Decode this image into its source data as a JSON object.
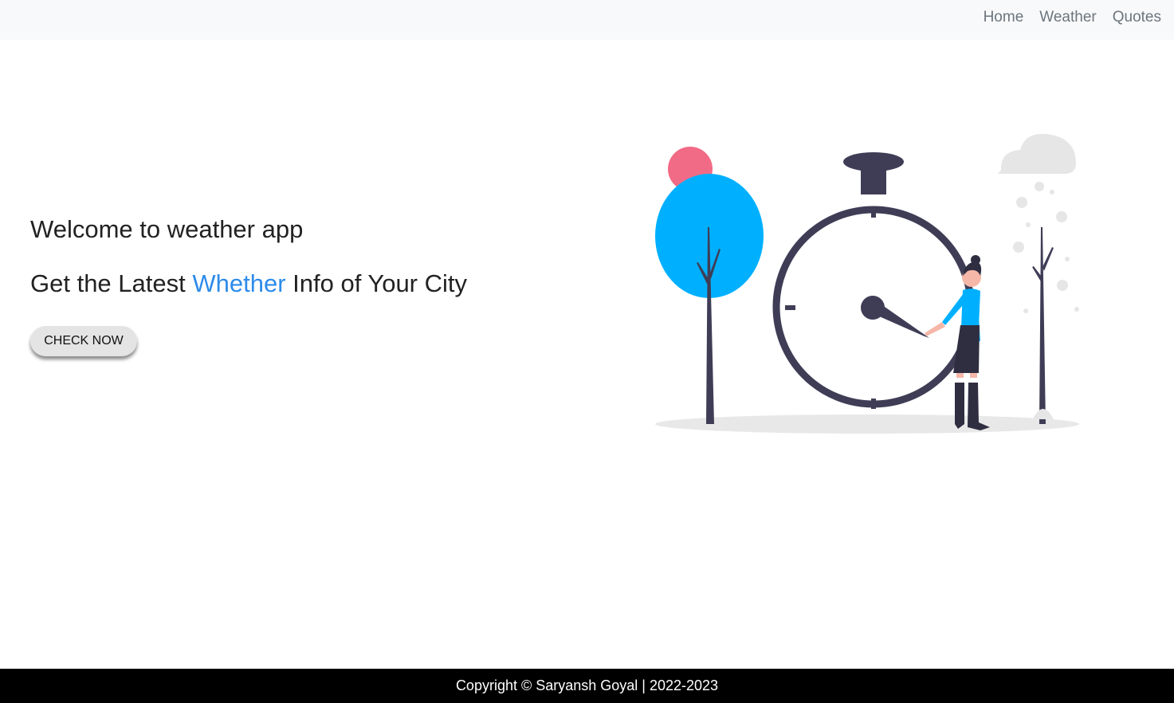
{
  "nav": {
    "links": [
      "Home",
      "Weather",
      "Quotes"
    ]
  },
  "hero": {
    "title": "Welcome to weather app",
    "subtitle_pre": "Get the Latest ",
    "subtitle_highlight": "Whether",
    "subtitle_post": " Info of Your City",
    "button_label": "CHECK NOW",
    "illustration_icon": "clock-illustration"
  },
  "footer": {
    "copyright": "Copyright © Saryansh Goyal | 2022-2023"
  },
  "colors": {
    "navbar_bg": "#f8f9fa",
    "highlight": "#2d8bea",
    "tree_blue": "#00b0ff",
    "clock_dark": "#3f3d56",
    "footer_bg": "#000000"
  }
}
